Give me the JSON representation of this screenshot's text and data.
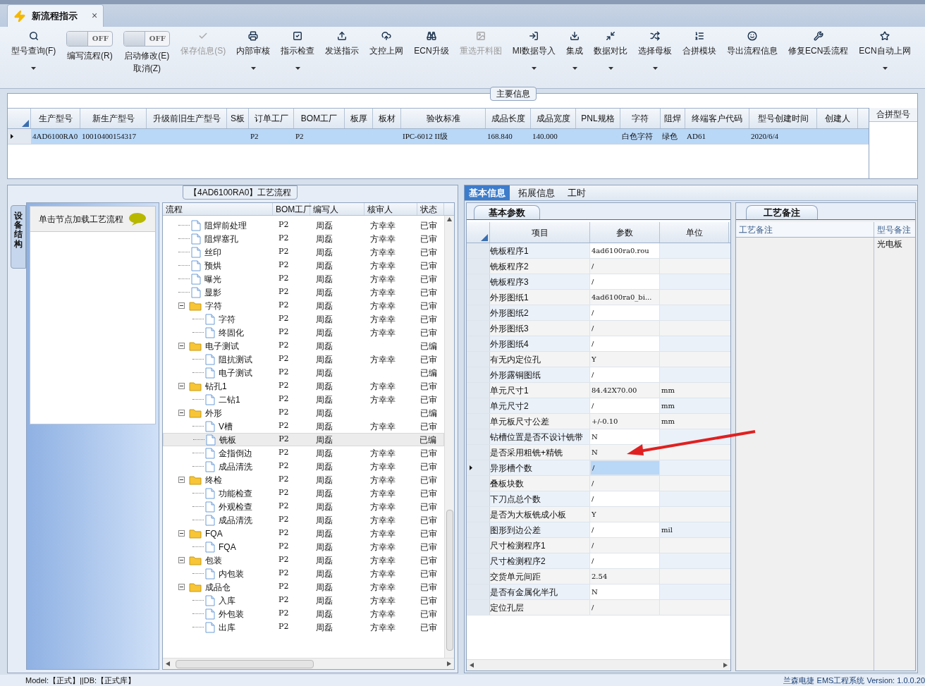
{
  "doc_tab": {
    "title": "新流程指示",
    "close": "×"
  },
  "toolbar": [
    {
      "kind": "button",
      "label": "型号查询(F)",
      "disabled": false,
      "dropdown": true
    },
    {
      "kind": "toggle",
      "switch": "OFF",
      "on": false,
      "label": "编写流程(R)"
    },
    {
      "kind": "toggle",
      "switch": "OFF",
      "on": false,
      "label": "启动修改(E)",
      "sublabel": "取消(Z)"
    },
    {
      "kind": "button",
      "label": "保存信息(S)",
      "disabled": true,
      "dropdown": false
    },
    {
      "kind": "button",
      "label": "内部审核",
      "disabled": false,
      "dropdown": true
    },
    {
      "kind": "button",
      "label": "指示检查",
      "disabled": false,
      "dropdown": true
    },
    {
      "kind": "button",
      "label": "发送指示",
      "disabled": false,
      "dropdown": false
    },
    {
      "kind": "button",
      "label": "文控上网",
      "disabled": false,
      "dropdown": false
    },
    {
      "kind": "button",
      "label": "ECN升级",
      "disabled": false,
      "dropdown": false
    },
    {
      "kind": "button",
      "label": "重选开料图",
      "disabled": true,
      "dropdown": false
    },
    {
      "kind": "button",
      "label": "MI数据导入",
      "disabled": false,
      "dropdown": true
    },
    {
      "kind": "button",
      "label": "集成",
      "disabled": false,
      "dropdown": true
    },
    {
      "kind": "button",
      "label": "数据对比",
      "disabled": false,
      "dropdown": true
    },
    {
      "kind": "button",
      "label": "选择母板",
      "disabled": false,
      "dropdown": true
    },
    {
      "kind": "button",
      "label": "合拼模块",
      "disabled": false,
      "dropdown": false
    },
    {
      "kind": "button",
      "label": "导出流程信息",
      "disabled": false,
      "dropdown": false
    },
    {
      "kind": "button",
      "label": "修复ECN丢流程",
      "disabled": false,
      "dropdown": false
    },
    {
      "kind": "button",
      "label": "ECN自动上网",
      "disabled": false,
      "dropdown": true
    }
  ],
  "main_info": {
    "title": "主要信息",
    "columns": [
      "生产型号",
      "新生产型号",
      "升级前旧生产型号",
      "S板",
      "订单工厂",
      "BOM工厂",
      "板厚",
      "板材",
      "验收标准",
      "成品长度",
      "成品宽度",
      "PNL规格",
      "字符",
      "阻焊",
      "终端客户代码",
      "型号创建时间",
      "创建人"
    ],
    "rows": [
      {
        "selected": true,
        "cells": [
          "4AD6100RA0",
          "10010400154317",
          null,
          null,
          "P2",
          "P2",
          null,
          null,
          "IPC-6012 II级",
          "168.840",
          "140.000",
          null,
          "白色字符",
          "绿色",
          "AD61",
          "2020/6/4",
          null
        ]
      }
    ],
    "side_column": "合拼型号"
  },
  "side_panel": {
    "tab": "设备结构",
    "hint": "单击节点加载工艺流程"
  },
  "flow": {
    "title": "【4AD6100RA0】工艺流程",
    "columns": [
      "流程",
      "BOM工厂",
      "编写人",
      "核审人",
      "状态"
    ],
    "tree": [
      {
        "kind": "file",
        "name": "阻焊前处理",
        "bom": "P2",
        "writer": "周磊",
        "reviewer": "方幸幸",
        "status": "已审",
        "selected": false
      },
      {
        "kind": "file",
        "name": "阻焊塞孔",
        "bom": "P2",
        "writer": "周磊",
        "reviewer": "方幸幸",
        "status": "已审",
        "selected": false
      },
      {
        "kind": "file",
        "name": "丝印",
        "bom": "P2",
        "writer": "周磊",
        "reviewer": "方幸幸",
        "status": "已审",
        "selected": false
      },
      {
        "kind": "file",
        "name": "预烘",
        "bom": "P2",
        "writer": "周磊",
        "reviewer": "方幸幸",
        "status": "已审",
        "selected": false
      },
      {
        "kind": "file",
        "name": "曝光",
        "bom": "P2",
        "writer": "周磊",
        "reviewer": "方幸幸",
        "status": "已审",
        "selected": false
      },
      {
        "kind": "file",
        "name": "显影",
        "bom": "P2",
        "writer": "周磊",
        "reviewer": "方幸幸",
        "status": "已审",
        "selected": false
      },
      {
        "kind": "folder",
        "name": "字符",
        "bom": "P2",
        "writer": "周磊",
        "reviewer": "方幸幸",
        "status": "已审",
        "selected": false,
        "expanded": true,
        "children": [
          {
            "kind": "file",
            "name": "字符",
            "bom": "P2",
            "writer": "周磊",
            "reviewer": "方幸幸",
            "status": "已审",
            "selected": false
          },
          {
            "kind": "file",
            "name": "终固化",
            "bom": "P2",
            "writer": "周磊",
            "reviewer": "方幸幸",
            "status": "已审",
            "selected": false
          }
        ]
      },
      {
        "kind": "folder",
        "name": "电子测试",
        "bom": "P2",
        "writer": "周磊",
        "status": "已编",
        "selected": false,
        "expanded": true,
        "children": [
          {
            "kind": "file",
            "name": "阻抗测试",
            "bom": "P2",
            "writer": "周磊",
            "reviewer": "方幸幸",
            "status": "已审",
            "selected": false
          },
          {
            "kind": "file",
            "name": "电子测试",
            "bom": "P2",
            "writer": "周磊",
            "status": "已编",
            "selected": false
          }
        ]
      },
      {
        "kind": "folder",
        "name": "钻孔1",
        "bom": "P2",
        "writer": "周磊",
        "reviewer": "方幸幸",
        "status": "已审",
        "selected": false,
        "expanded": true,
        "children": [
          {
            "kind": "file",
            "name": "二钻1",
            "bom": "P2",
            "writer": "周磊",
            "reviewer": "方幸幸",
            "status": "已审",
            "selected": false
          }
        ]
      },
      {
        "kind": "folder",
        "name": "外形",
        "bom": "P2",
        "writer": "周磊",
        "status": "已编",
        "selected": false,
        "expanded": true,
        "children": [
          {
            "kind": "file",
            "name": "V槽",
            "bom": "P2",
            "writer": "周磊",
            "reviewer": "方幸幸",
            "status": "已审",
            "selected": false
          },
          {
            "kind": "file",
            "name": "铣板",
            "bom": "P2",
            "writer": "周磊",
            "status": "已编",
            "selected": true
          },
          {
            "kind": "file",
            "name": "金指倒边",
            "bom": "P2",
            "writer": "周磊",
            "reviewer": "方幸幸",
            "status": "已审",
            "selected": false
          },
          {
            "kind": "file",
            "name": "成品清洗",
            "bom": "P2",
            "writer": "周磊",
            "reviewer": "方幸幸",
            "status": "已审",
            "selected": false
          }
        ]
      },
      {
        "kind": "folder",
        "name": "终检",
        "bom": "P2",
        "writer": "周磊",
        "reviewer": "方幸幸",
        "status": "已审",
        "selected": false,
        "expanded": true,
        "children": [
          {
            "kind": "file",
            "name": "功能检查",
            "bom": "P2",
            "writer": "周磊",
            "reviewer": "方幸幸",
            "status": "已审",
            "selected": false
          },
          {
            "kind": "file",
            "name": "外观检查",
            "bom": "P2",
            "writer": "周磊",
            "reviewer": "方幸幸",
            "status": "已审",
            "selected": false
          },
          {
            "kind": "file",
            "name": "成品清洗",
            "bom": "P2",
            "writer": "周磊",
            "reviewer": "方幸幸",
            "status": "已审",
            "selected": false
          }
        ]
      },
      {
        "kind": "folder",
        "name": "FQA",
        "bom": "P2",
        "writer": "周磊",
        "reviewer": "方幸幸",
        "status": "已审",
        "selected": false,
        "expanded": true,
        "children": [
          {
            "kind": "file",
            "name": "FQA",
            "bom": "P2",
            "writer": "周磊",
            "reviewer": "方幸幸",
            "status": "已审",
            "selected": false
          }
        ]
      },
      {
        "kind": "folder",
        "name": "包装",
        "bom": "P2",
        "writer": "周磊",
        "reviewer": "方幸幸",
        "status": "已审",
        "selected": false,
        "expanded": true,
        "children": [
          {
            "kind": "file",
            "name": "内包装",
            "bom": "P2",
            "writer": "周磊",
            "reviewer": "方幸幸",
            "status": "已审",
            "selected": false
          }
        ]
      },
      {
        "kind": "folder",
        "name": "成品仓",
        "bom": "P2",
        "writer": "周磊",
        "reviewer": "方幸幸",
        "status": "已审",
        "selected": false,
        "expanded": true,
        "children": [
          {
            "kind": "file",
            "name": "入库",
            "bom": "P2",
            "writer": "周磊",
            "reviewer": "方幸幸",
            "status": "已审",
            "selected": false
          },
          {
            "kind": "file",
            "name": "外包装",
            "bom": "P2",
            "writer": "周磊",
            "reviewer": "方幸幸",
            "status": "已审",
            "selected": false
          },
          {
            "kind": "file",
            "name": "出库",
            "bom": "P2",
            "writer": "周磊",
            "reviewer": "方幸幸",
            "status": "已审",
            "selected": false
          }
        ]
      }
    ]
  },
  "detail_tabs": [
    {
      "label": "基本信息",
      "selected": true
    },
    {
      "label": "拓展信息",
      "selected": false
    },
    {
      "label": "工时",
      "selected": false
    }
  ],
  "params": {
    "tab": "基本参数",
    "columns": [
      "项目",
      "参数",
      "单位"
    ],
    "rows": [
      {
        "item": "铣板程序1",
        "value": "4ad6100ra0.rou",
        "selected": false
      },
      {
        "item": "铣板程序2",
        "value": "/",
        "selected": false
      },
      {
        "item": "铣板程序3",
        "value": "/",
        "selected": false
      },
      {
        "item": "外形图纸1",
        "value": "4ad6100ra0_bi...",
        "selected": false
      },
      {
        "item": "外形图纸2",
        "value": "/",
        "selected": false
      },
      {
        "item": "外形图纸3",
        "value": "/",
        "selected": false
      },
      {
        "item": "外形图纸4",
        "value": "/",
        "selected": false
      },
      {
        "item": "有无内定位孔",
        "value": "Y",
        "selected": false
      },
      {
        "item": "外形露铜图纸",
        "value": "/",
        "selected": false
      },
      {
        "item": "单元尺寸1",
        "value": "84.42X70.00",
        "unit": "mm",
        "selected": false
      },
      {
        "item": "单元尺寸2",
        "value": "/",
        "unit": "mm",
        "selected": false
      },
      {
        "item": "单元板尺寸公差",
        "value": "+/-0.10",
        "unit": "mm",
        "selected": false
      },
      {
        "item": "钻槽位置是否不设计铣带",
        "value": "N",
        "selected": false
      },
      {
        "item": "是否采用粗铣+精铣",
        "value": "N",
        "selected": false
      },
      {
        "item": "异形槽个数",
        "value": "/",
        "selected": true
      },
      {
        "item": "叠板块数",
        "value": "/",
        "selected": false
      },
      {
        "item": "下刀点总个数",
        "value": "/",
        "selected": false
      },
      {
        "item": "是否为大板铣成小板",
        "value": "Y",
        "selected": false
      },
      {
        "item": "图形到边公差",
        "value": "/",
        "unit": "mil",
        "selected": false
      },
      {
        "item": "尺寸检测程序1",
        "value": "/",
        "selected": false
      },
      {
        "item": "尺寸检测程序2",
        "value": "/",
        "selected": false
      },
      {
        "item": "交货单元间距",
        "value": "2.54",
        "selected": false
      },
      {
        "item": "是否有金属化半孔",
        "value": "N",
        "selected": false
      },
      {
        "item": "定位孔层",
        "value": "/",
        "selected": false
      }
    ]
  },
  "remarks": {
    "tab": "工艺备注",
    "columns": [
      "工艺备注",
      "型号备注"
    ],
    "model_remark": "光电板"
  },
  "status_bar": {
    "left": "Model:【正式】||DB:【正式库】",
    "right": "兰森电捷 EMS工程系统 Version: 1.0.0.20"
  }
}
